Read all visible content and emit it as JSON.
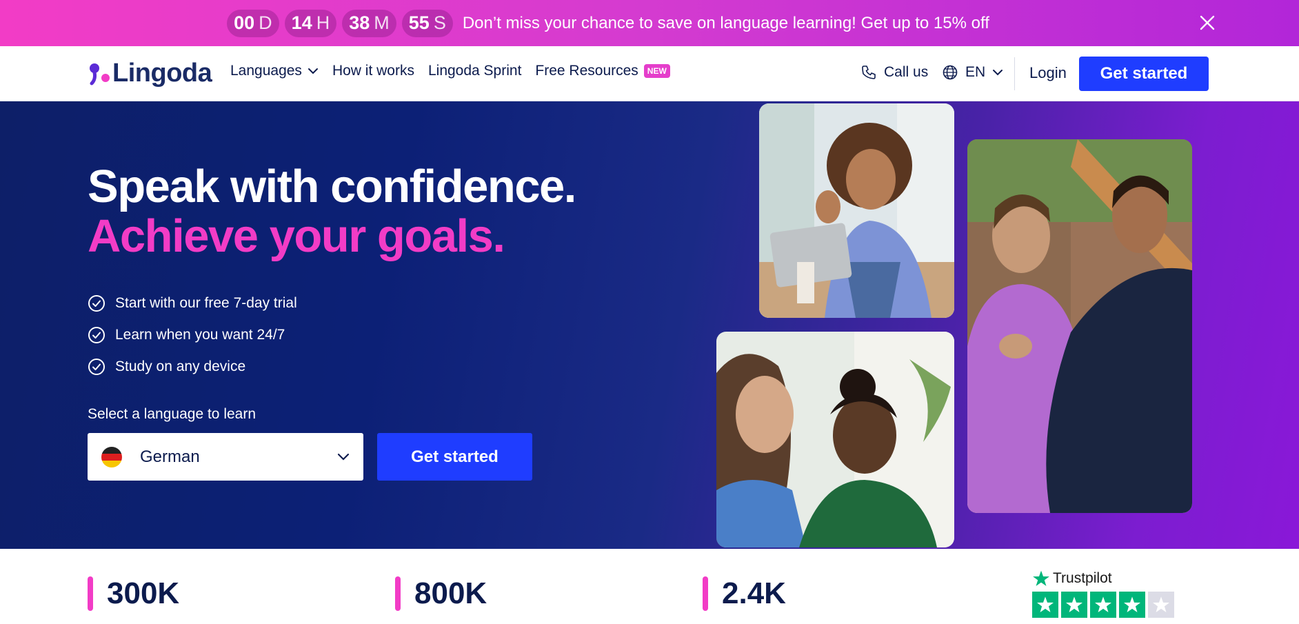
{
  "promo": {
    "timer": [
      {
        "num": "00",
        "unit": "D"
      },
      {
        "num": "14",
        "unit": "H"
      },
      {
        "num": "38",
        "unit": "M"
      },
      {
        "num": "55",
        "unit": "S"
      }
    ],
    "message": "Don’t miss your chance to save on language learning! Get up to 15% off",
    "close_icon": "close-icon"
  },
  "header": {
    "logo_text": "Lingoda",
    "nav": [
      {
        "label": "Languages",
        "icon": "chevron-down-icon"
      },
      {
        "label": "How it works"
      },
      {
        "label": "Lingoda Sprint"
      },
      {
        "label": "Free Resources",
        "badge": "NEW"
      }
    ],
    "call_label": "Call us",
    "language_label": "EN",
    "login_label": "Login",
    "cta_label": "Get started"
  },
  "hero": {
    "title_line1": "Speak with confidence.",
    "title_line2": "Achieve your goals.",
    "bullets": [
      "Start with our free 7-day trial",
      "Learn when you want 24/7",
      "Study on any device"
    ],
    "select_label": "Select a language to learn",
    "selected_language": "German",
    "cta_label": "Get started"
  },
  "stats": [
    {
      "value": "300K"
    },
    {
      "value": "800K"
    },
    {
      "value": "2.4K"
    }
  ],
  "trustpilot": {
    "brand": "Trustpilot",
    "rating_stars": 4,
    "max_stars": 5
  },
  "colors": {
    "accent_pink": "#f23cc6",
    "cta_blue": "#1f3dff",
    "navy": "#0c1b4d",
    "trustpilot_green": "#00b67a"
  }
}
